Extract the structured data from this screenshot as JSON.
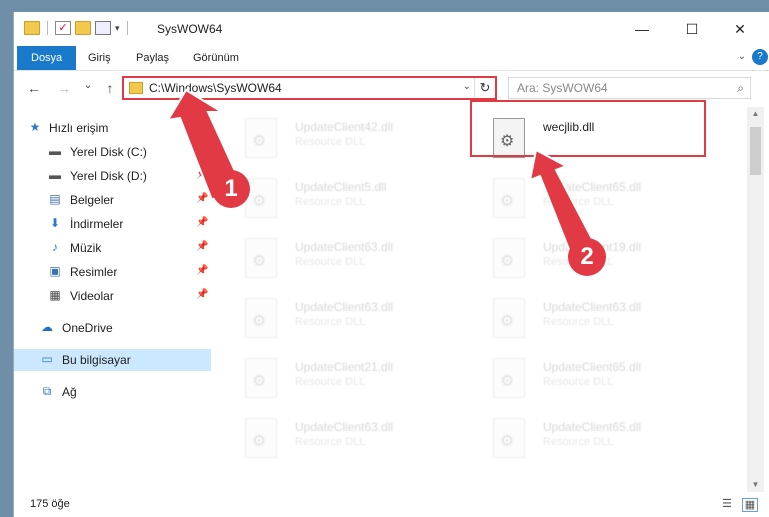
{
  "window": {
    "title": "SysWOW64",
    "minimize": "—",
    "maximize": "☐",
    "close": "✕"
  },
  "ribbon": {
    "tabs": [
      "Dosya",
      "Giriş",
      "Paylaş",
      "Görünüm"
    ],
    "expand": "⌄",
    "help": "?"
  },
  "nav": {
    "back": "←",
    "forward": "→",
    "recent": "⌄",
    "up": "↑",
    "address": "C:\\Windows\\SysWOW64",
    "refresh": "↻",
    "search_placeholder": "Ara: SysWOW64",
    "search_icon": "⌕"
  },
  "sidebar": {
    "items": [
      {
        "label": "Hızlı erişim",
        "icon": "star-icon"
      },
      {
        "label": "Yerel Disk (C:)",
        "icon": "drive-icon"
      },
      {
        "label": "Yerel Disk (D:)",
        "icon": "drive-icon"
      },
      {
        "label": "Belgeler",
        "icon": "documents-icon"
      },
      {
        "label": "İndirmeler",
        "icon": "download-icon"
      },
      {
        "label": "Müzik",
        "icon": "music-icon"
      },
      {
        "label": "Resimler",
        "icon": "pictures-icon"
      },
      {
        "label": "Videolar",
        "icon": "video-icon"
      },
      {
        "label": "OneDrive",
        "icon": "cloud-icon"
      },
      {
        "label": "Bu bilgisayar",
        "icon": "computer-icon"
      },
      {
        "label": "Ağ",
        "icon": "network-icon"
      }
    ]
  },
  "files": [
    {
      "name": "UpdateClient42.dll",
      "type": "Resource DLL"
    },
    {
      "name": "wecjlib.dll",
      "type": ""
    },
    {
      "name": "UpdateClient5.dll",
      "type": "Resource DLL"
    },
    {
      "name": "UpdateClient65.dll",
      "type": "Resource DLL"
    },
    {
      "name": "UpdateClient63.dll",
      "type": "Resource DLL"
    },
    {
      "name": "UpdateClient19.dll",
      "type": "Resource DLL"
    },
    {
      "name": "UpdateClient63.dll",
      "type": "Resource DLL"
    },
    {
      "name": "UpdateClient63.dll",
      "type": "Resource DLL"
    },
    {
      "name": "UpdateClient21.dll",
      "type": "Resource DLL"
    },
    {
      "name": "UpdateClient65.dll",
      "type": "Resource DLL"
    },
    {
      "name": "UpdateClient63.dll",
      "type": "Resource DLL"
    },
    {
      "name": "UpdateClient65.dll",
      "type": "Resource DLL"
    }
  ],
  "status": {
    "count": "175 öğe"
  },
  "callouts": [
    "1",
    "2"
  ],
  "colors": {
    "accent": "#1979ca",
    "highlight": "#e23a45"
  }
}
